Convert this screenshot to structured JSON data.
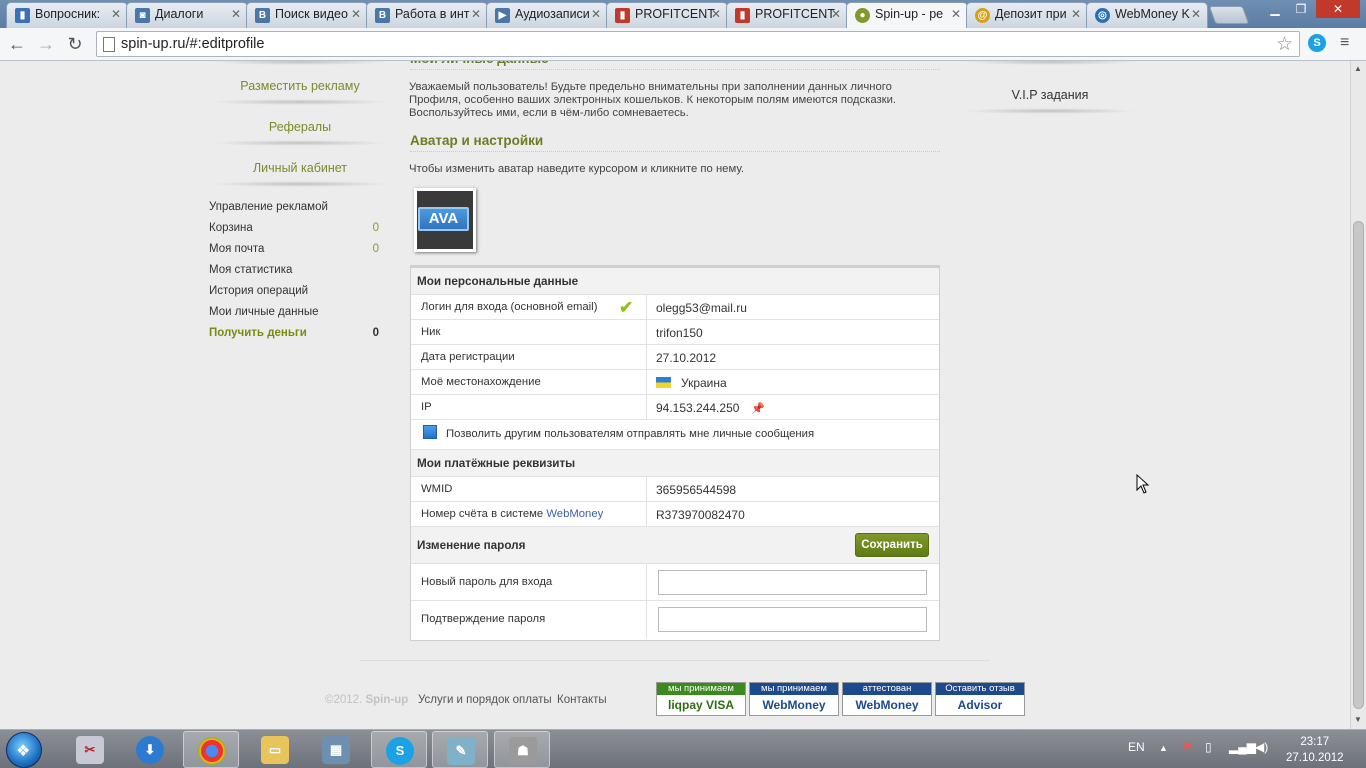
{
  "browser": {
    "tabs": [
      {
        "label": "Вопросник: ",
        "icon": "chart-icon",
        "color": "#3b6fb6",
        "active": false
      },
      {
        "label": "Диалоги",
        "icon": "chat-icon",
        "color": "#4a76a8",
        "active": false
      },
      {
        "label": "Поиск видео",
        "icon": "vk-icon",
        "color": "#4a76a8",
        "active": false
      },
      {
        "label": "Работа в инт",
        "icon": "vk-icon",
        "color": "#4a76a8",
        "active": false
      },
      {
        "label": "Аудиозаписи",
        "icon": "play-icon",
        "color": "#4a76a8",
        "active": false
      },
      {
        "label": "PROFITCENT",
        "icon": "chart-icon",
        "color": "#c0392b",
        "active": false
      },
      {
        "label": "PROFITCENT",
        "icon": "chart-icon",
        "color": "#c0392b",
        "active": false
      },
      {
        "label": "Spin-up - ре",
        "icon": "spinup-icon",
        "color": "#7f9a2a",
        "active": true
      },
      {
        "label": "Депозит при",
        "icon": "deposit-icon",
        "color": "#d4a017",
        "active": false
      },
      {
        "label": "WebMoney K",
        "icon": "webmoney-icon",
        "color": "#2a6fb6",
        "active": false
      }
    ],
    "url": "spin-up.ru/#:editprofile"
  },
  "left_nav": {
    "links": [
      "Разместить рекламу",
      "Рефералы",
      "Личный кабинет"
    ],
    "cabinet": [
      {
        "label": "Управление рекламой",
        "count": ""
      },
      {
        "label": "Корзина",
        "count": "0"
      },
      {
        "label": "Моя почта",
        "count": "0"
      },
      {
        "label": "Моя статистика",
        "count": ""
      },
      {
        "label": "История операций",
        "count": ""
      },
      {
        "label": "Мои личные данные",
        "count": ""
      },
      {
        "label": "Получить деньги",
        "count": "0"
      }
    ]
  },
  "main": {
    "section1_title": "Мои личные данные",
    "notice": "Уважаемый пользователь! Будьте предельно внимательны при заполнении данных личного Профиля, особенно ваших электронных кошельков. К некоторым полям имеются подсказки. Воспользуйтесь ими, если в чём-либо сомневаетесь.",
    "section2_title": "Аватар и настройки",
    "avatar_hint": "Чтобы изменить аватар наведите курсором и кликните по нему.",
    "avatar_text": "AVA",
    "personal_header": "Мои персональные данные",
    "rows": [
      {
        "label": "Логин для входа (основной email)",
        "value": "olegg53@mail.ru"
      },
      {
        "label": "Ник",
        "value": "trifon150"
      },
      {
        "label": "Дата регистрации",
        "value": "27.10.2012"
      },
      {
        "label": "Моё местонахождение",
        "value": "Украина"
      },
      {
        "label": "IP",
        "value": "94.153.244.250"
      }
    ],
    "allow_messages": "Позволить другим пользователям отправлять мне личные сообщения",
    "payment_header": "Мои платёжные реквизиты",
    "wmid_label": "WMID",
    "wmid_value": "365956544598",
    "purse_label_prefix": "Номер счёта в системе ",
    "purse_label_link": "WebMoney",
    "purse_value": "R373970082470",
    "password_header": "Изменение пароля",
    "save_label": "Сохранить",
    "new_password_label": "Новый пароль для входа",
    "confirm_password_label": "Подтверждение пароля"
  },
  "right": {
    "vip": "V.I.P задания"
  },
  "footer": {
    "copyright_year": "©2012.",
    "copyright_name": "Spin-up",
    "services": "Услуги и порядок оплаты",
    "contacts": "Контакты",
    "badges": [
      {
        "top": "мы принимаем",
        "bottom": "liqpay VISA",
        "color": "#3b8a1e"
      },
      {
        "top": "мы принимаем",
        "bottom": "WebMoney",
        "color": "#1c4a8c"
      },
      {
        "top": "аттестован",
        "bottom": "WebMoney",
        "color": "#1c4a8c"
      },
      {
        "top": "Оставить отзыв",
        "bottom": "Advisor",
        "color": "#1c4a8c"
      }
    ]
  },
  "taskbar": {
    "language": "EN",
    "time": "23:17",
    "date": "27.10.2012"
  }
}
